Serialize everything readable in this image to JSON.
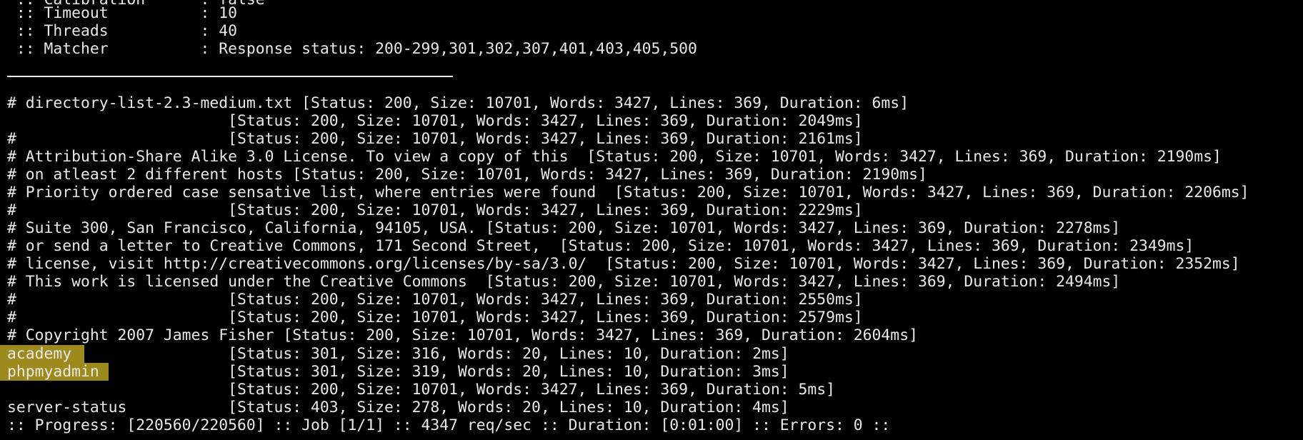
{
  "terminal": {
    "background": "#000000",
    "foreground": "#e8e8e8",
    "highlight_color": "#9c8a1d",
    "config": {
      "partial_top": " :: Calibration      : false",
      "timeout": " :: Timeout          : 10",
      "threads": " :: Threads          : 40",
      "matcher": " :: Matcher          : Response status: 200-299,301,302,307,401,403,405,500"
    },
    "separator": "________________________________________________",
    "results": [
      "# directory-list-2.3-medium.txt [Status: 200, Size: 10701, Words: 3427, Lines: 369, Duration: 6ms]",
      "                        [Status: 200, Size: 10701, Words: 3427, Lines: 369, Duration: 2049ms]",
      "#                       [Status: 200, Size: 10701, Words: 3427, Lines: 369, Duration: 2161ms]",
      "# Attribution-Share Alike 3.0 License. To view a copy of this  [Status: 200, Size: 10701, Words: 3427, Lines: 369, Duration: 2190ms]",
      "# on atleast 2 different hosts [Status: 200, Size: 10701, Words: 3427, Lines: 369, Duration: 2190ms]",
      "# Priority ordered case sensative list, where entries were found  [Status: 200, Size: 10701, Words: 3427, Lines: 369, Duration: 2206ms]",
      "#                       [Status: 200, Size: 10701, Words: 3427, Lines: 369, Duration: 2229ms]",
      "# Suite 300, San Francisco, California, 94105, USA. [Status: 200, Size: 10701, Words: 3427, Lines: 369, Duration: 2278ms]",
      "# or send a letter to Creative Commons, 171 Second Street,  [Status: 200, Size: 10701, Words: 3427, Lines: 369, Duration: 2349ms]",
      "# license, visit http://creativecommons.org/licenses/by-sa/3.0/  [Status: 200, Size: 10701, Words: 3427, Lines: 369, Duration: 2352ms]",
      "# This work is licensed under the Creative Commons  [Status: 200, Size: 10701, Words: 3427, Lines: 369, Duration: 2494ms]",
      "#                       [Status: 200, Size: 10701, Words: 3427, Lines: 369, Duration: 2550ms]",
      "#                       [Status: 200, Size: 10701, Words: 3427, Lines: 369, Duration: 2579ms]",
      "# Copyright 2007 James Fisher [Status: 200, Size: 10701, Words: 3427, Lines: 369, Duration: 2604ms]",
      "academy                 [Status: 301, Size: 316, Words: 20, Lines: 10, Duration: 2ms]",
      "phpmyadmin              [Status: 301, Size: 319, Words: 20, Lines: 10, Duration: 3ms]",
      "                        [Status: 200, Size: 10701, Words: 3427, Lines: 369, Duration: 5ms]",
      "server-status           [Status: 403, Size: 278, Words: 20, Lines: 10, Duration: 4ms]"
    ],
    "progress": ":: Progress: [220560/220560] :: Job [1/1] :: 4347 req/sec :: Duration: [0:01:00] :: Errors: 0 ::"
  }
}
